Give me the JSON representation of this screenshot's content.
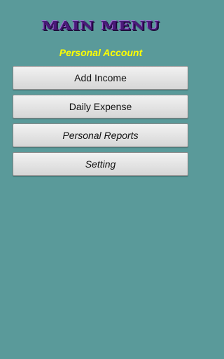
{
  "header": {
    "logo_text": "MAIN MENU",
    "subtitle": "Personal Account"
  },
  "menu": {
    "items": [
      {
        "label": "Add Income"
      },
      {
        "label": "Daily Expense"
      },
      {
        "label": "Personal Reports"
      },
      {
        "label": "Setting"
      }
    ]
  },
  "colors": {
    "background": "#5a9a9a",
    "subtitle": "#ffff00",
    "logo": "#4b1a7a",
    "button": "#e4e4e4"
  }
}
